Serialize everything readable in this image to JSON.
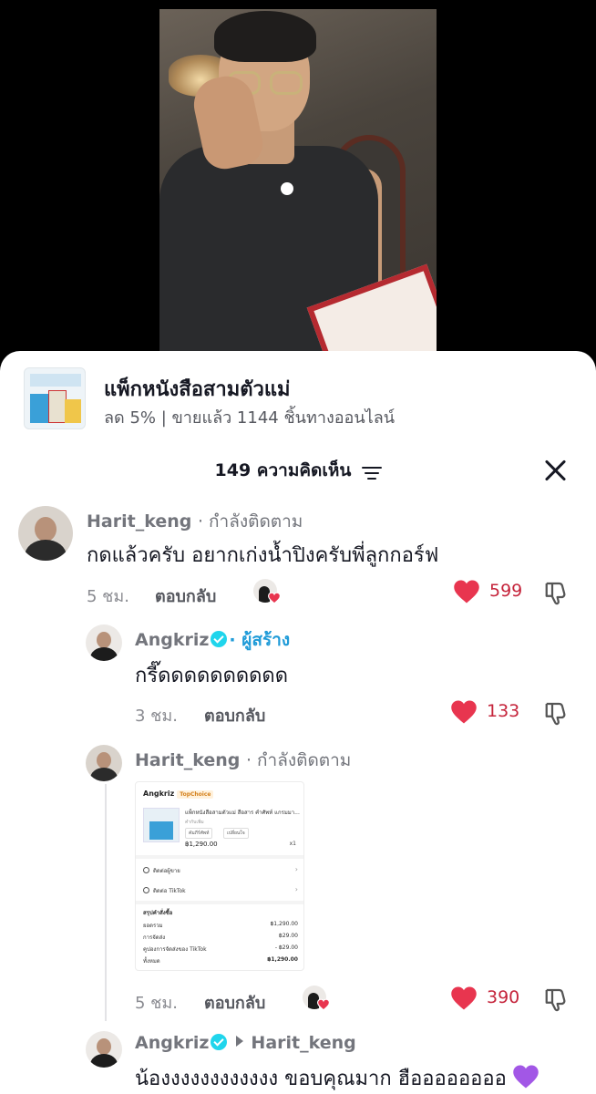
{
  "product": {
    "title": "แพ็กหนังสือสามตัวแม่",
    "subtitle": "ลด 5% | ขายแล้ว 1144 ชิ้นทางออนไลน์"
  },
  "comments_header": {
    "count_label": "149 ความคิดเห็น"
  },
  "colors": {
    "like": "#c5243b",
    "creator": "#1f9bd8",
    "verified": "#20d5ec",
    "purple_heart": "#a257e6"
  },
  "comments": [
    {
      "username": "Harit_keng",
      "tag": "· กำลังติดตาม",
      "text": "กดแล้วครับ อยากเก่งน้ำปิงครับพี่ลูกกอร์ฟ",
      "time": "5 ชม.",
      "reply_label": "ตอบกลับ",
      "likes": "599"
    },
    {
      "username": "Angkriz",
      "tag": "· ผู้สร้าง",
      "text": "กรี๊ดดดดดดดดดด",
      "time": "3 ชม.",
      "reply_label": "ตอบกลับ",
      "likes": "133"
    },
    {
      "username": "Harit_keng",
      "tag": "· กำลังติดตาม",
      "time": "5 ชม.",
      "reply_label": "ตอบกลับ",
      "likes": "390",
      "attachment": {
        "shop": "Angkriz",
        "badge": "TopChoice",
        "item_title": "แพ็กหนังสือสามตัวแม่ สือสาร คำศัพท์ แกรมมา...",
        "item_sub": "คำกับเพิ่ม",
        "options": [
          "คัมภีร์ศัพท์",
          "เปลี่ยนใจ"
        ],
        "price": "฿1,290.00",
        "qty": "x1",
        "contact_seller": "ติดต่อผู้ขาย",
        "contact_tiktok": "ติดต่อ TikTok",
        "summary_title": "สรุปคำสั่งซื้อ",
        "rows": [
          {
            "label": "ยอดรวม",
            "value": "฿1,290.00"
          },
          {
            "label": "การจัดส่ง",
            "value": "฿29.00"
          },
          {
            "label": "คูปองการจัดส่งของ TikTok",
            "value": "- ฿29.00"
          },
          {
            "label": "ทั้งหมด",
            "value": "฿1,290.00"
          }
        ]
      }
    },
    {
      "username": "Angkriz",
      "reply_to": "Harit_keng",
      "text": "น้องงงงงงงงงงงง ขอบคุณมาก ฮืออออออออ"
    }
  ]
}
